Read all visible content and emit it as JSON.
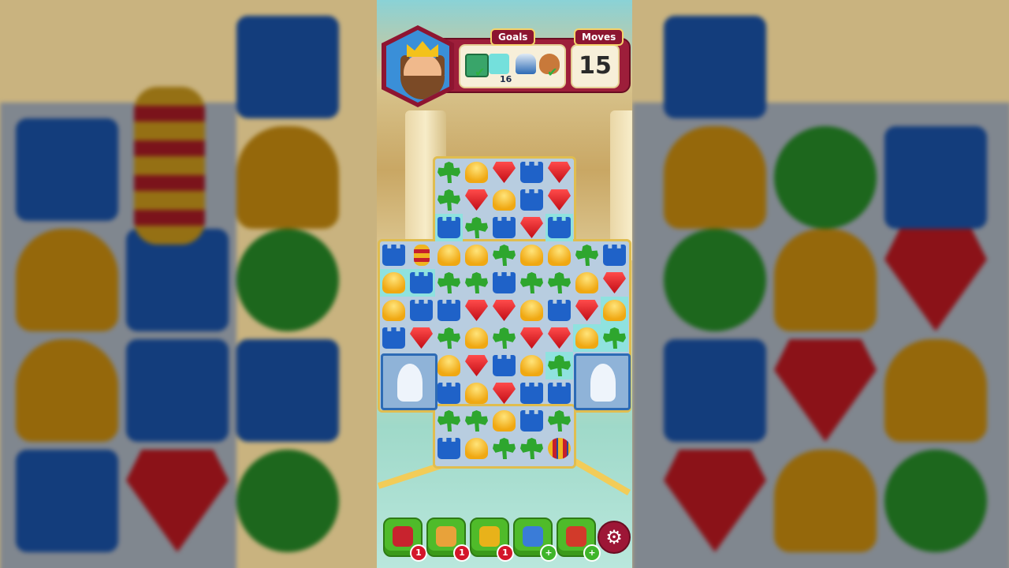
{
  "hud": {
    "goals_label": "Goals",
    "moves_label": "Moves",
    "moves_value": "15",
    "goals": [
      {
        "icon": "green-tile-icon",
        "status": "done"
      },
      {
        "icon": "teal-tile-icon",
        "count": "16"
      },
      {
        "icon": "tower-jar-icon",
        "status": "pending"
      },
      {
        "icon": "pot-icon",
        "status": "done"
      }
    ],
    "avatar_icon": "king-avatar-icon"
  },
  "board": {
    "pieces": {
      "T": "tower-piece",
      "H": "helmet-piece",
      "R": "red-gem-piece",
      "C": "clover-piece",
      "V": "vertical-rocket-piece",
      "X": "horizontal-rocket-piece",
      "S": "statue-obstacle"
    }
  },
  "boosters": [
    {
      "icon": "mailbox-icon",
      "badge": "1"
    },
    {
      "icon": "hand-punch-icon",
      "badge": "1"
    },
    {
      "icon": "cannon-icon",
      "badge": "1"
    },
    {
      "icon": "wizard-hat-icon",
      "badge": "+"
    },
    {
      "icon": "firework-icon",
      "badge": "+"
    }
  ],
  "settings_icon": "gear-icon",
  "colors": {
    "hud_red": "#9d1e3a",
    "gold": "#e0bd4f",
    "tower_blue": "#1f62c8",
    "clover_green": "#2ea62e",
    "gem_red": "#e01d26",
    "helmet_gold": "#f0a812"
  }
}
